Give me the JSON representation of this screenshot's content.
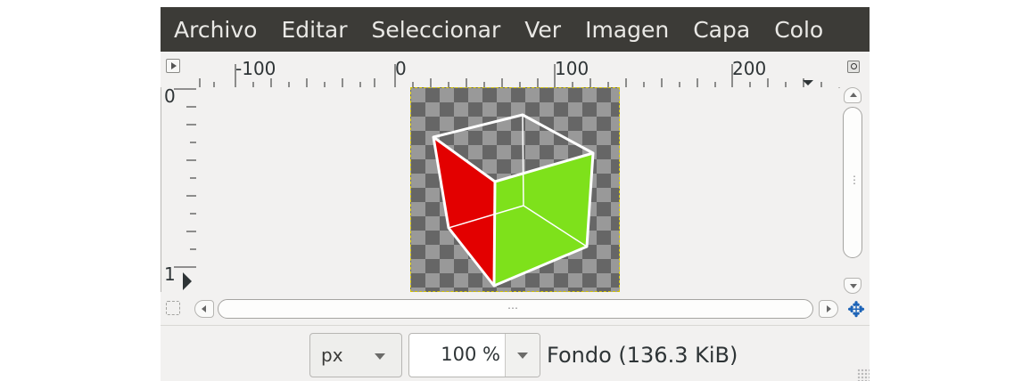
{
  "menubar": {
    "items": [
      "Archivo",
      "Editar",
      "Seleccionar",
      "Ver",
      "Imagen",
      "Capa",
      "Colo"
    ]
  },
  "rulers": {
    "horizontal_labels": [
      "-100",
      "0",
      "100",
      "200"
    ],
    "vertical_labels": [
      "0",
      "1"
    ]
  },
  "image": {
    "name": "cube",
    "colors": {
      "left_face": "#e30000",
      "right_face": "#7ee11b",
      "edges": "#ffffff",
      "selection_border": "#d4c400"
    }
  },
  "statusbar": {
    "unit": "px",
    "zoom": "100 %",
    "layer_info": "Fondo (136.3 KiB)"
  },
  "icons": {
    "menu_button": "triangle-right-icon",
    "zoom_toggle": "magnifier-icon",
    "quick_mask": "dashed-square-icon",
    "navigate": "four-way-arrow-icon"
  }
}
